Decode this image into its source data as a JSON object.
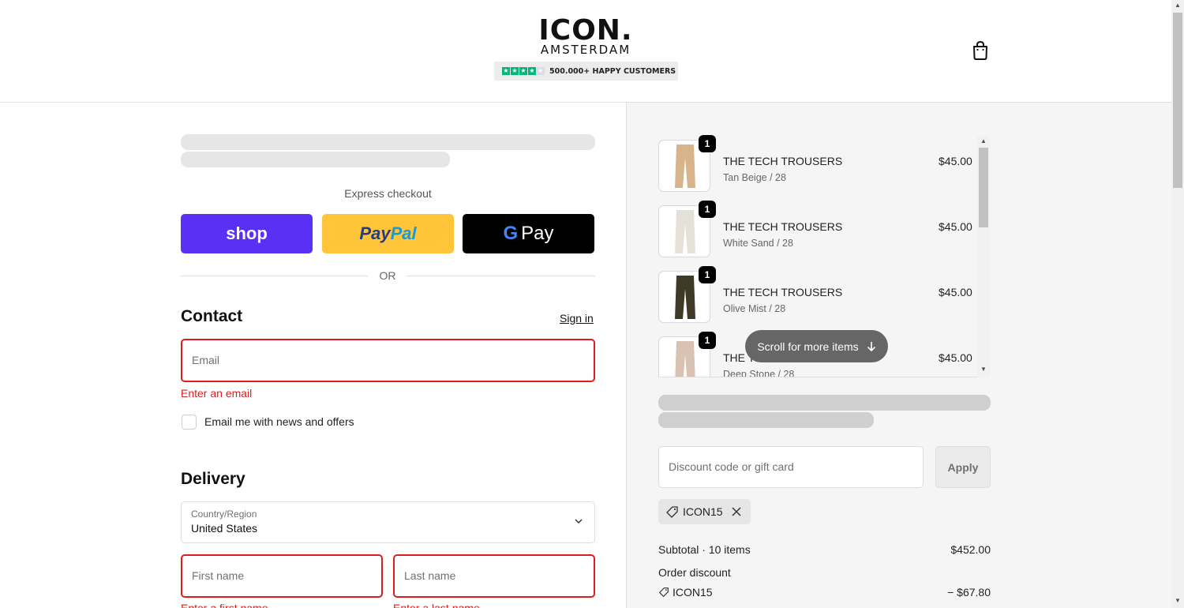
{
  "header": {
    "logo_main": "ICON.",
    "logo_sub": "AMSTERDAM",
    "rating_text": "500.000+ HAPPY CUSTOMERS",
    "rating_stars": 4,
    "cart_icon": "shopping-bag-icon"
  },
  "express": {
    "label": "Express checkout",
    "shop_label": "shop",
    "paypal_label_1": "Pay",
    "paypal_label_2": "Pal",
    "gpay_label": "Pay",
    "gpay_g": "G",
    "or_label": "OR"
  },
  "contact": {
    "heading": "Contact",
    "signin_label": "Sign in",
    "email_placeholder": "Email",
    "email_error": "Enter an email",
    "news_label": "Email me with news and offers"
  },
  "delivery": {
    "heading": "Delivery",
    "country_label": "Country/Region",
    "country_value": "United States",
    "first_name_placeholder": "First name",
    "last_name_placeholder": "Last name",
    "first_name_error": "Enter a first name",
    "last_name_error": "Enter a last name"
  },
  "cart": {
    "items": [
      {
        "title": "THE TECH TROUSERS",
        "variant": "Tan Beige / 28",
        "price": "$45.00",
        "qty": "1",
        "color": "#d8b48a"
      },
      {
        "title": "THE TECH TROUSERS",
        "variant": "White Sand / 28",
        "price": "$45.00",
        "qty": "1",
        "color": "#e4e2d8"
      },
      {
        "title": "THE TECH TROUSERS",
        "variant": "Olive Mist / 28",
        "price": "$45.00",
        "qty": "1",
        "color": "#3f3a26"
      },
      {
        "title": "THE TECH TROUSERS",
        "variant": "Deep Stone / 28",
        "price": "$45.00",
        "qty": "1",
        "color": "#d9c2b2"
      }
    ],
    "scroll_hint": "Scroll for more items",
    "discount_placeholder": "Discount code or gift card",
    "apply_label": "Apply",
    "applied_code": "ICON15"
  },
  "summary": {
    "subtotal_label": "Subtotal · 10 items",
    "subtotal_value": "$452.00",
    "order_discount_label": "Order discount",
    "discount_code": "ICON15",
    "discount_value": "− $67.80"
  },
  "colors": {
    "shop": "#5a31f4",
    "paypal": "#ffc439",
    "error": "#dd1d1d"
  }
}
